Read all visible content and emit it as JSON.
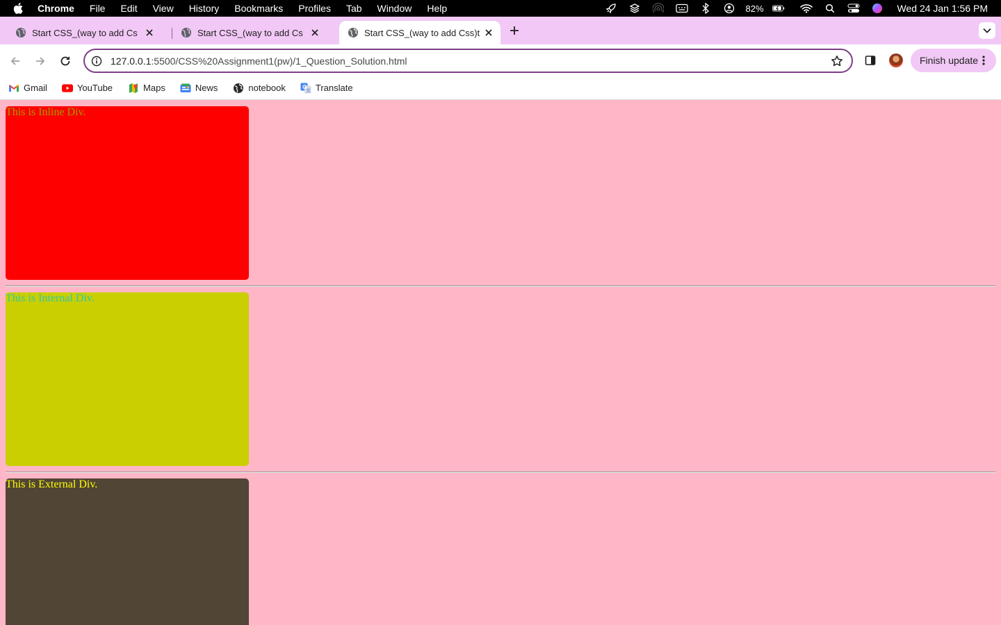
{
  "menubar": {
    "app_name": "Chrome",
    "items": [
      "File",
      "Edit",
      "View",
      "History",
      "Bookmarks",
      "Profiles",
      "Tab",
      "Window",
      "Help"
    ],
    "battery": "82%",
    "clock": "Wed 24 Jan  1:56 PM"
  },
  "tabs": [
    {
      "title": "Start CSS_(way to add Css)ti"
    },
    {
      "title": "Start CSS_(way to add Css)ti"
    },
    {
      "title": "Start CSS_(way to add Css)ti"
    }
  ],
  "toolbar": {
    "url_host": "127.0.0.1",
    "url_rest": ":5500/CSS%20Assignment1(pw)/1_Question_Solution.html",
    "update_label": "Finish update"
  },
  "bookmarks": [
    {
      "label": "Gmail",
      "icon": "gmail-icon"
    },
    {
      "label": "YouTube",
      "icon": "youtube-icon"
    },
    {
      "label": "Maps",
      "icon": "maps-icon"
    },
    {
      "label": "News",
      "icon": "news-icon"
    },
    {
      "label": "notebook",
      "icon": "globe-icon"
    },
    {
      "label": "Translate",
      "icon": "translate-icon"
    }
  ],
  "page": {
    "inline_text": "This is Inline Div.",
    "internal_text": "This is Internal Div.",
    "external_text": "This is External Div."
  },
  "colors": {
    "page_background": "#ffb6c6",
    "inline_box": "#ff0000",
    "internal_box": "#c9cf00",
    "external_box": "#514535",
    "tab_strip": "#f2c8f6"
  }
}
